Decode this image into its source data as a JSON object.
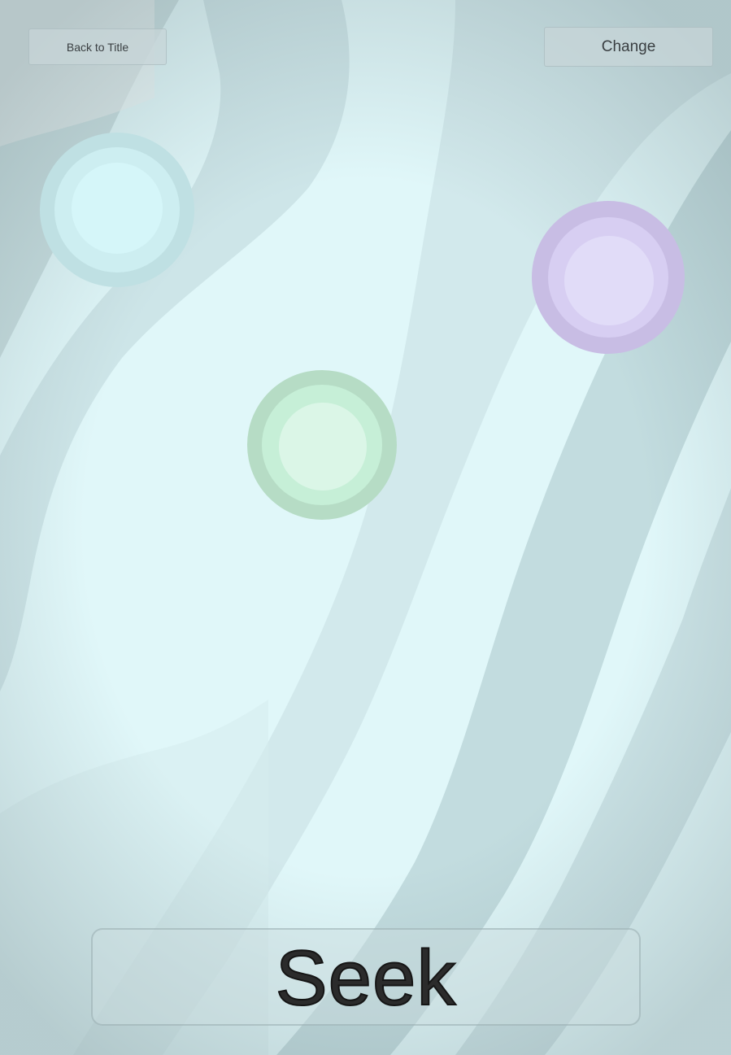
{
  "header": {
    "back_label": "Back to Title",
    "change_label": "Change"
  },
  "footer": {
    "action_label": "Seek"
  },
  "colors": {
    "background_light": "#dff6f8",
    "background_stripe": "#c3dde0",
    "orb_cyan": "#cdeef1",
    "orb_purple": "#d7cef2",
    "orb_green": "#c6efd7"
  },
  "orbs": [
    {
      "color": "cyan"
    },
    {
      "color": "purple"
    },
    {
      "color": "green"
    }
  ]
}
